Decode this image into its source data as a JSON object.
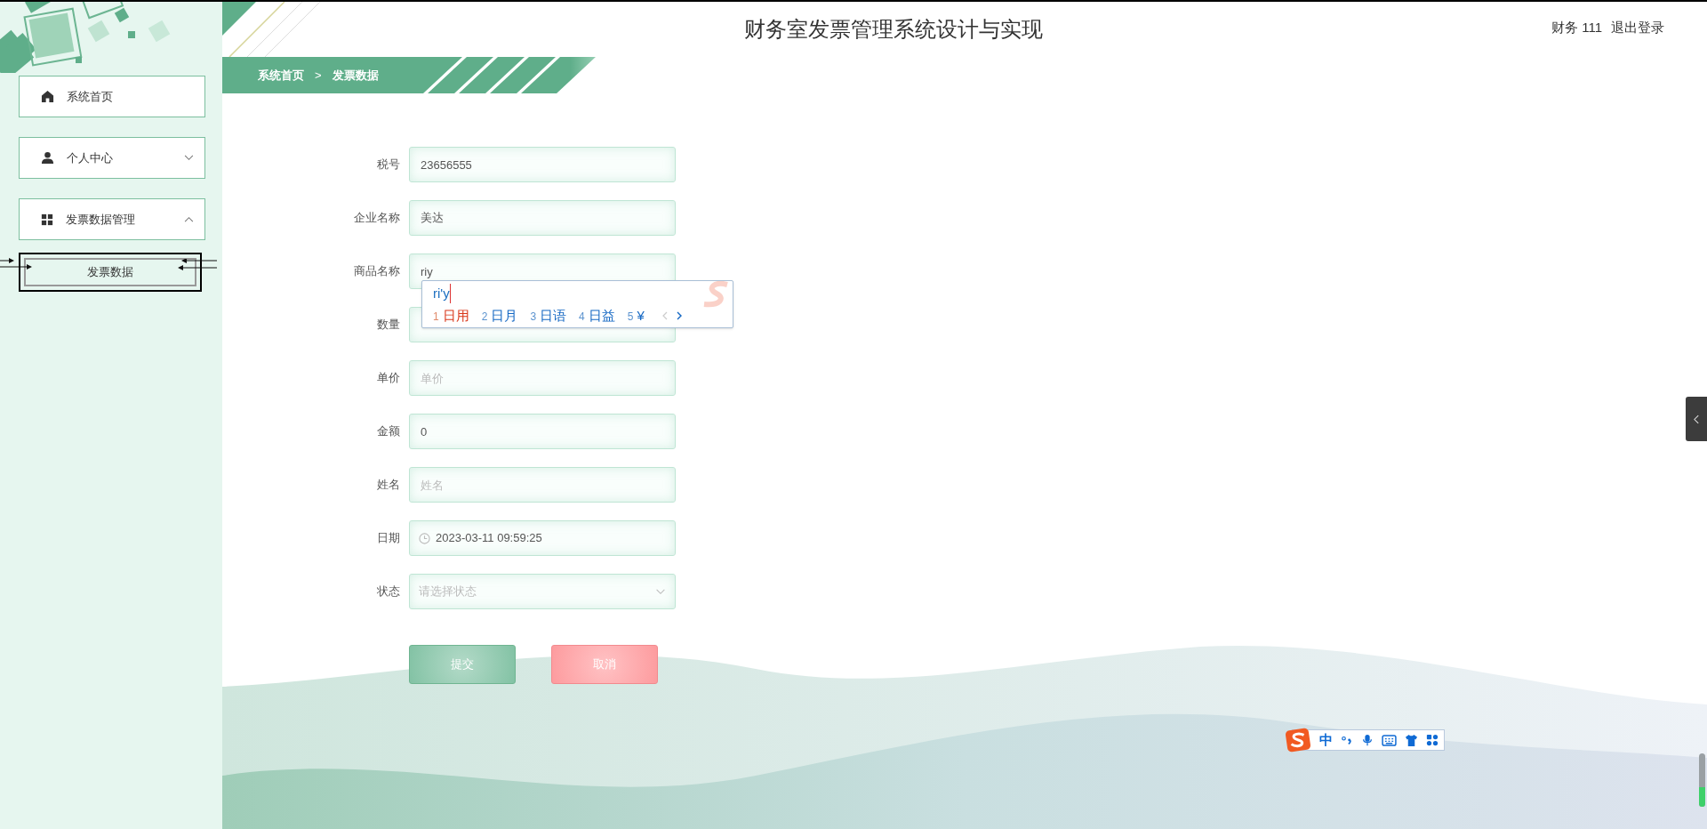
{
  "header": {
    "title": "财务室发票管理系统设计与实现",
    "user": "财务 111",
    "logout": "退出登录"
  },
  "breadcrumb": {
    "items": [
      "系统首页",
      "发票数据"
    ],
    "separator": ">"
  },
  "sidebar": {
    "items": [
      {
        "label": "系统首页",
        "kind": "link"
      },
      {
        "label": "个人中心",
        "kind": "group",
        "expanded": false
      },
      {
        "label": "发票数据管理",
        "kind": "group",
        "expanded": true,
        "children": [
          {
            "label": "发票数据",
            "selected": true
          }
        ]
      }
    ]
  },
  "form": {
    "fields": [
      {
        "label": "税号",
        "kind": "input",
        "value": "23656555"
      },
      {
        "label": "企业名称",
        "kind": "input",
        "value": "美达"
      },
      {
        "label": "商品名称",
        "kind": "input",
        "value": "riy"
      },
      {
        "label": "数量",
        "kind": "input"
      },
      {
        "label": "单价",
        "kind": "input",
        "placeholder": "单价"
      },
      {
        "label": "金额",
        "kind": "input",
        "value": "0"
      },
      {
        "label": "姓名",
        "kind": "input",
        "placeholder": "姓名"
      },
      {
        "label": "日期",
        "kind": "date",
        "value": "2023-03-11 09:59:25"
      },
      {
        "label": "状态",
        "kind": "select",
        "placeholder": "请选择状态"
      }
    ],
    "buttons": [
      {
        "label": "提交",
        "kind": "primary"
      },
      {
        "label": "取消",
        "kind": "danger"
      }
    ]
  },
  "ime_popup": {
    "composition": "ri'y",
    "candidates": [
      {
        "index": "1",
        "text": "日用",
        "selected": true
      },
      {
        "index": "2",
        "text": "日月",
        "selected": false
      },
      {
        "index": "3",
        "text": "日语",
        "selected": false
      },
      {
        "index": "4",
        "text": "日益",
        "selected": false
      },
      {
        "index": "5",
        "text": "¥",
        "selected": false
      }
    ]
  },
  "ime_toolbar": {
    "mode": "中"
  }
}
